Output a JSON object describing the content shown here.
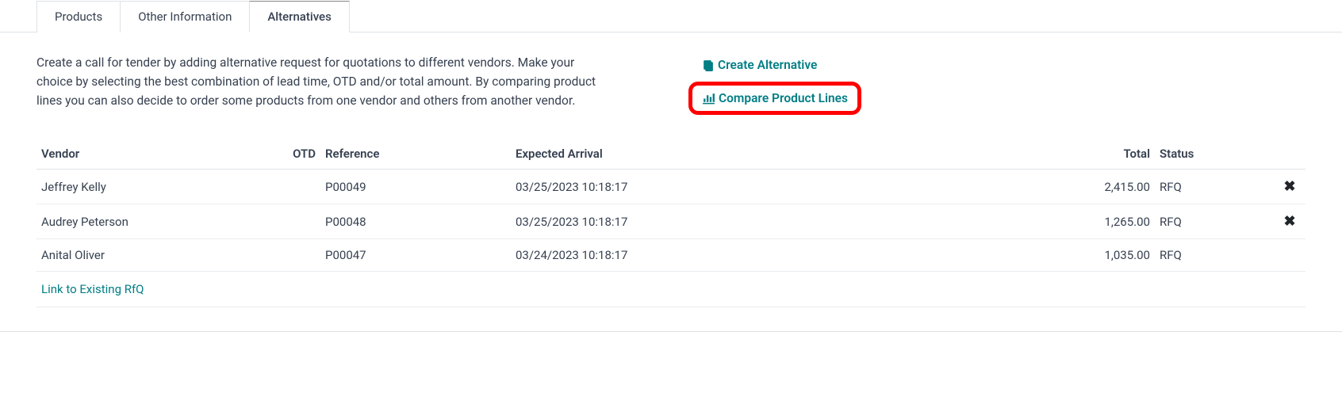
{
  "tabs": {
    "products": "Products",
    "other_info": "Other Information",
    "alternatives": "Alternatives"
  },
  "description": "Create a call for tender by adding alternative request for quotations to different vendors. Make your choice by selecting the best combination of lead time, OTD and/or total amount. By comparing product lines you can also decide to order some products from one vendor and others from another vendor.",
  "actions": {
    "create_alternative": "Create Alternative",
    "compare_product_lines": "Compare Product Lines"
  },
  "columns": {
    "vendor": "Vendor",
    "otd": "OTD",
    "reference": "Reference",
    "expected_arrival": "Expected Arrival",
    "total": "Total",
    "status": "Status"
  },
  "rows": [
    {
      "vendor": "Jeffrey Kelly",
      "otd": "",
      "reference": "P00049",
      "expected_arrival": "03/25/2023 10:18:17",
      "total": "2,415.00",
      "status": "RFQ",
      "deletable": true
    },
    {
      "vendor": "Audrey Peterson",
      "otd": "",
      "reference": "P00048",
      "expected_arrival": "03/25/2023 10:18:17",
      "total": "1,265.00",
      "status": "RFQ",
      "deletable": true
    },
    {
      "vendor": "Anital Oliver",
      "otd": "",
      "reference": "P00047",
      "expected_arrival": "03/24/2023 10:18:17",
      "total": "1,035.00",
      "status": "RFQ",
      "deletable": false
    }
  ],
  "link_existing": "Link to Existing RfQ"
}
